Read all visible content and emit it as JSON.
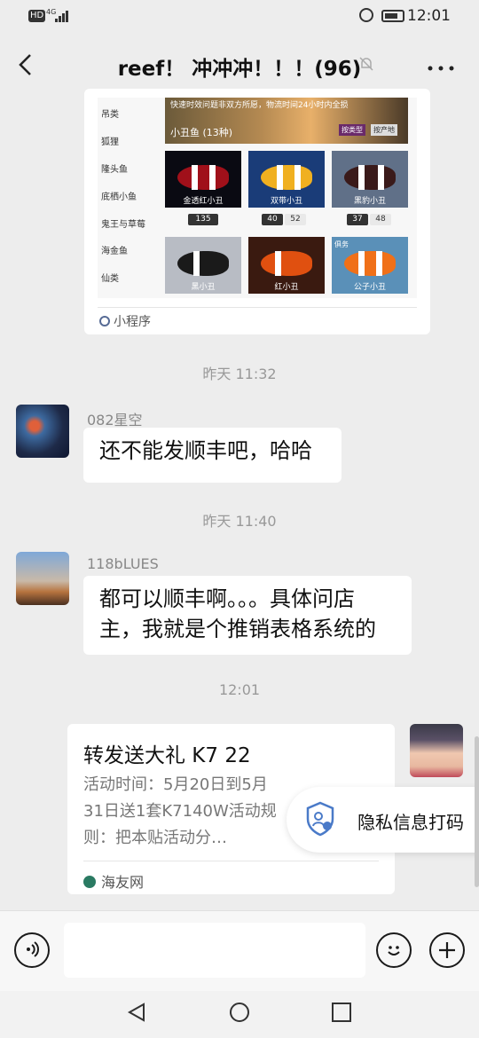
{
  "status_bar": {
    "hd": "HD",
    "net": "4G",
    "time": "12:01"
  },
  "header": {
    "title": "reef！ 冲冲冲！！！(96)"
  },
  "mini_program": {
    "categories": [
      "吊类",
      "狐狸",
      "隆头鱼",
      "底栖小鱼",
      "鬼王与草莓",
      "海金鱼",
      "仙类"
    ],
    "banner_text": "快速时效问题非双方所愿，物流时间24小时内全损",
    "banner_title": "小丑鱼 (13种)",
    "banner_tag1": "按类型",
    "banner_tag2": "按产地",
    "fish": [
      {
        "name": "金透红小丑",
        "color": "#a0101a",
        "count": "135",
        "count2": ""
      },
      {
        "name": "双带小丑",
        "color": "#f0b020",
        "count": "40",
        "count2": "52"
      },
      {
        "name": "黑豹小丑",
        "color": "#3a1a1a",
        "count": "37",
        "count2": "48"
      },
      {
        "name": "黑小丑",
        "color": "#1a1a1a",
        "count": "",
        "count2": ""
      },
      {
        "name": "红小丑",
        "color": "#e05010",
        "count": "",
        "count2": ""
      },
      {
        "name": "公子小丑",
        "color": "#f07018",
        "count": "",
        "count2": ""
      }
    ],
    "fish6_tag": "俱务",
    "label": "小程序"
  },
  "timestamps": [
    "昨天 11:32",
    "昨天 11:40",
    "12:01"
  ],
  "messages": [
    {
      "sender": "082星空",
      "text": "还不能发顺丰吧，哈哈"
    },
    {
      "sender": "118bLUES",
      "text": "都可以顺丰啊。。。具体问店主，我就是个推销表格系统的"
    }
  ],
  "article": {
    "title": "转发送大礼 K7 22",
    "desc": "活动时间：5月20日到5月31日送1套K7140W活动规则：把本贴活动分…",
    "source": "海友网"
  },
  "privacy_popup": {
    "text": "隐私信息打码"
  },
  "input_bar": {
    "voice_icon": "voice-icon",
    "emoji_icon": "emoji-icon",
    "plus_icon": "plus-icon"
  },
  "nav": {
    "back": "back-triangle-icon",
    "home": "home-circle-icon",
    "recent": "recent-square-icon"
  }
}
